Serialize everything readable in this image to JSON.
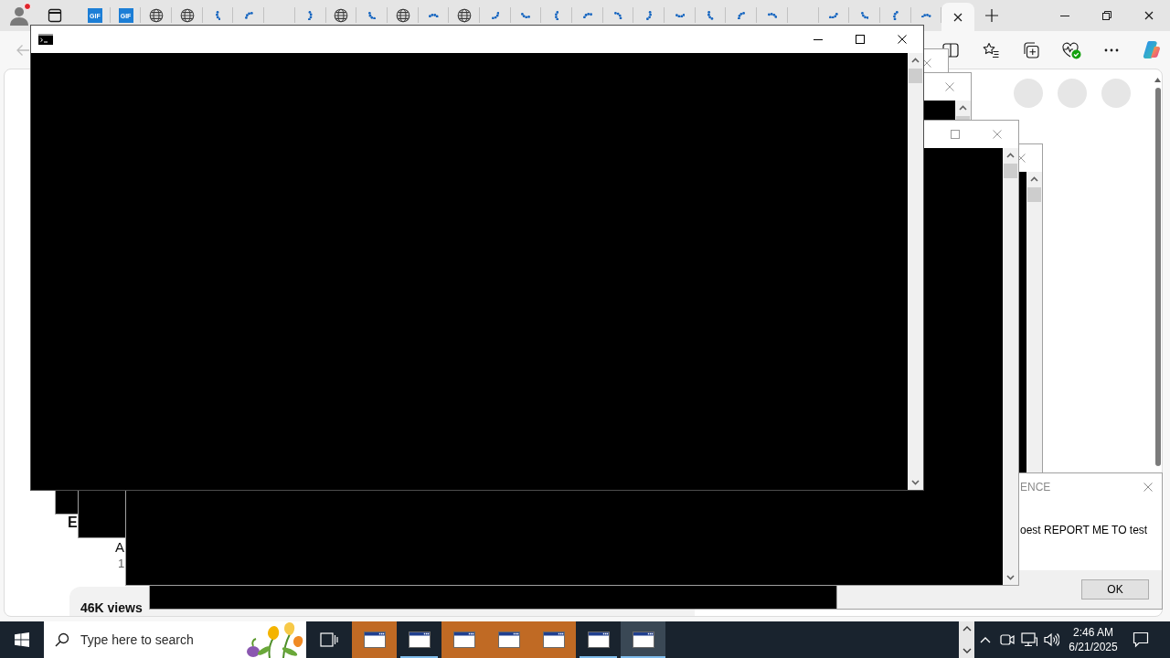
{
  "browser": {
    "tabs": [
      {
        "kind": "gif",
        "badge": "GIF",
        "selected": false
      },
      {
        "kind": "gif",
        "badge": "GIF",
        "selected": false
      },
      {
        "kind": "globe",
        "selected": false
      },
      {
        "kind": "globe",
        "selected": false
      },
      {
        "kind": "loading",
        "selected": false
      },
      {
        "kind": "loading",
        "selected": false
      },
      {
        "kind": "blank",
        "selected": false
      },
      {
        "kind": "loading",
        "selected": false
      },
      {
        "kind": "globe",
        "selected": false
      },
      {
        "kind": "loading",
        "selected": false
      },
      {
        "kind": "globe",
        "selected": false
      },
      {
        "kind": "loading",
        "selected": false
      },
      {
        "kind": "globe",
        "selected": false
      },
      {
        "kind": "loading",
        "selected": false
      },
      {
        "kind": "loading",
        "selected": false
      },
      {
        "kind": "loading",
        "selected": false
      },
      {
        "kind": "loading",
        "selected": false
      },
      {
        "kind": "loading",
        "selected": false
      },
      {
        "kind": "loading",
        "selected": false
      },
      {
        "kind": "loading",
        "selected": false
      },
      {
        "kind": "loading",
        "selected": false
      },
      {
        "kind": "loading",
        "selected": false
      },
      {
        "kind": "loading",
        "selected": false
      },
      {
        "kind": "blank",
        "selected": false
      },
      {
        "kind": "loading",
        "selected": false
      },
      {
        "kind": "loading",
        "selected": false
      },
      {
        "kind": "loading",
        "selected": false
      },
      {
        "kind": "loading",
        "selected": false
      },
      {
        "kind": "blank",
        "selected": true
      }
    ],
    "back_button": {
      "disabled": true
    },
    "page": {
      "fragments": [
        {
          "kind": "bold",
          "text": "E"
        },
        {
          "kind": "plain",
          "text": "A"
        },
        {
          "kind": "muted",
          "text": "1"
        }
      ],
      "views": "46K views"
    }
  },
  "console_windows": [
    {
      "active": true
    },
    {
      "active": false
    },
    {
      "active": false
    },
    {
      "active": false
    },
    {
      "active": false
    }
  ],
  "dialog": {
    "title": "ENCE",
    "message": "oest REPORT ME TO test",
    "active": false,
    "buttons": [
      "OK"
    ]
  },
  "taskbar": {
    "search": {
      "placeholder": "Type here to search"
    },
    "apps": [
      {
        "flashing": true,
        "selected": false
      },
      {
        "flashing": false,
        "selected": false
      },
      {
        "flashing": true,
        "selected": false
      },
      {
        "flashing": true,
        "selected": false
      },
      {
        "flashing": true,
        "selected": false
      },
      {
        "flashing": false,
        "selected": false
      },
      {
        "flashing": false,
        "selected": true
      }
    ],
    "clock": {
      "time": "2:46 AM",
      "date": "6/21/2025"
    }
  }
}
